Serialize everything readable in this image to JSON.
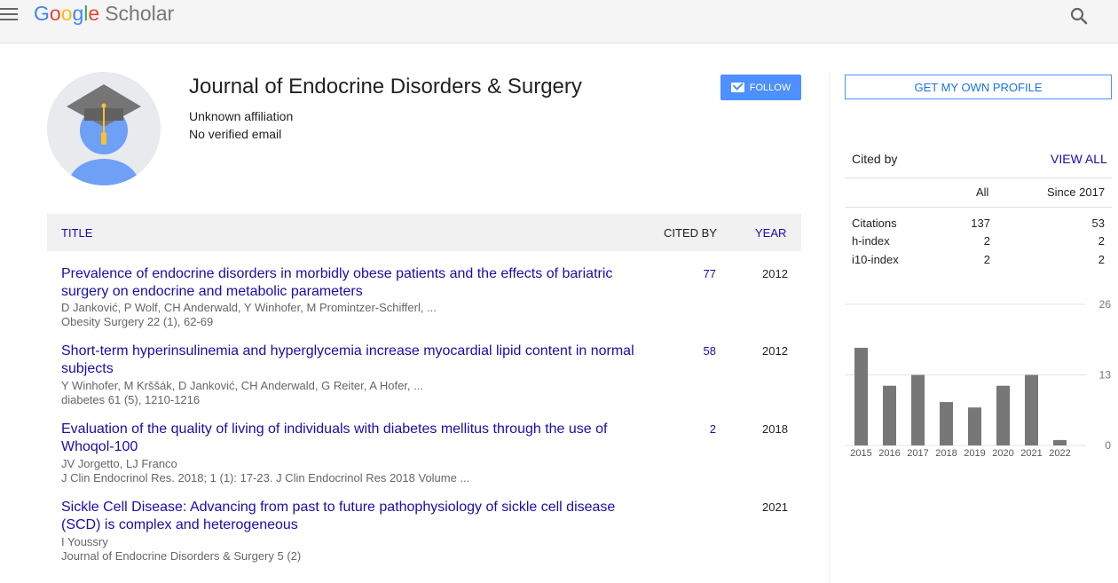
{
  "header": {
    "logo_google": [
      "G",
      "o",
      "o",
      "g",
      "l",
      "e"
    ],
    "logo_scholar": "Scholar",
    "menu_icon": "menu-icon",
    "search_icon": "search-icon"
  },
  "profile": {
    "name": "Journal of Endocrine Disorders & Surgery",
    "affiliation": "Unknown affiliation",
    "email": "No verified email",
    "follow_label": "FOLLOW"
  },
  "table": {
    "col_title": "TITLE",
    "col_cited": "CITED BY",
    "col_year": "YEAR",
    "rows": [
      {
        "title": "Prevalence of endocrine disorders in morbidly obese patients and the effects of bariatric surgery on endocrine and metabolic parameters",
        "authors": "D Janković, P Wolf, CH Anderwald, Y Winhofer, M Promintzer-Schifferl, ...",
        "venue": "Obesity Surgery 22 (1), 62-69",
        "cited": "77",
        "year": "2012"
      },
      {
        "title": "Short-term hyperinsulinemia and hyperglycemia increase myocardial lipid content in normal subjects",
        "authors": "Y Winhofer, M Krššák, D Janković, CH Anderwald, G Reiter, A Hofer, ...",
        "venue": "diabetes 61 (5), 1210-1216",
        "cited": "58",
        "year": "2012"
      },
      {
        "title": "Evaluation of the quality of living of individuals with diabetes mellitus through the use of Whoqol-100",
        "authors": "JV Jorgetto, LJ Franco",
        "venue": "J Clin Endocrinol Res. 2018; 1 (1): 17-23. J Clin Endocrinol Res 2018 Volume ...",
        "cited": "2",
        "year": "2018"
      },
      {
        "title": "Sickle Cell Disease: Advancing from past to future pathophysiology of sickle cell disease (SCD) is complex and heterogeneous",
        "authors": "I Youssry",
        "venue": "Journal of Endocrine Disorders & Surgery 5 (2)",
        "cited": "",
        "year": "2021"
      }
    ]
  },
  "sidebar": {
    "get_profile": "GET MY OWN PROFILE",
    "cited_by": "Cited by",
    "view_all": "VIEW ALL",
    "col_all": "All",
    "col_since": "Since 2017",
    "stats": [
      {
        "label": "Citations",
        "all": "137",
        "since": "53"
      },
      {
        "label": "h-index",
        "all": "2",
        "since": "2"
      },
      {
        "label": "i10-index",
        "all": "2",
        "since": "2"
      }
    ]
  },
  "chart_data": {
    "type": "bar",
    "categories": [
      "2015",
      "2016",
      "2017",
      "2018",
      "2019",
      "2020",
      "2021",
      "2022"
    ],
    "values": [
      18,
      11,
      13,
      8,
      7,
      11,
      13,
      1
    ],
    "ylim": [
      0,
      26
    ],
    "yticks": [
      "0",
      "13",
      "26"
    ],
    "bar_color": "#777777",
    "grid": true
  }
}
